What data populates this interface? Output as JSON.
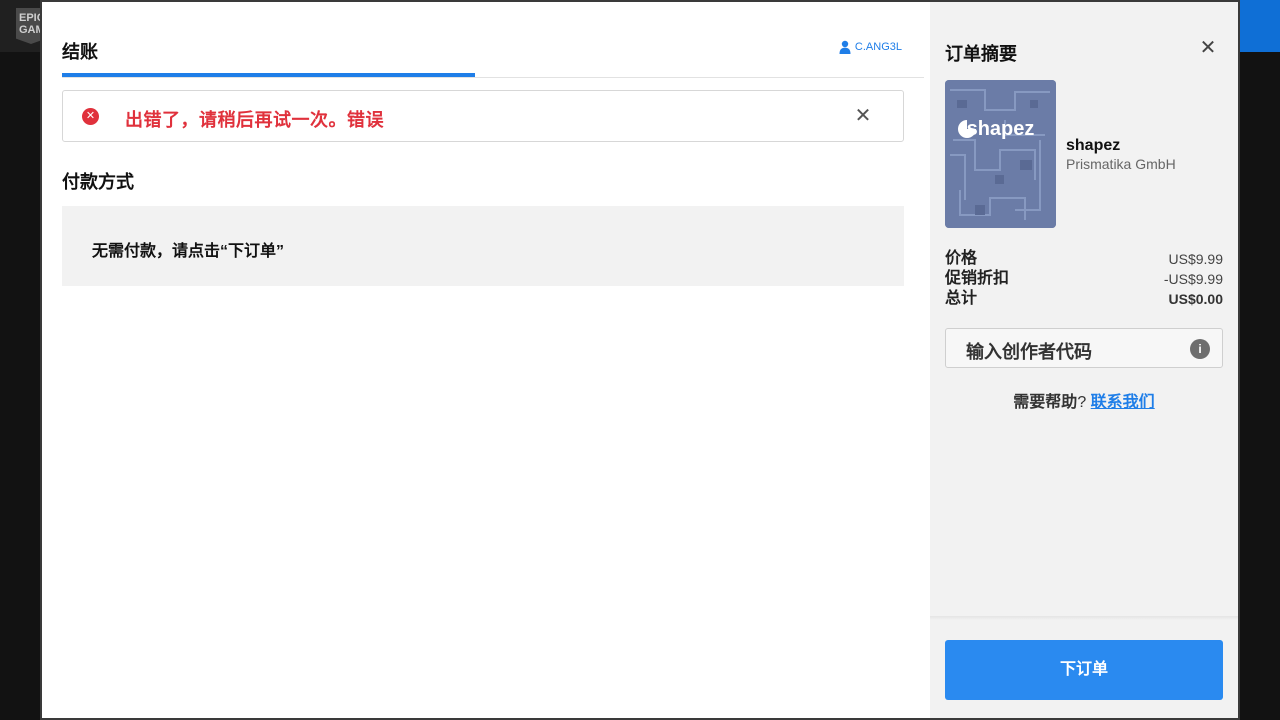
{
  "background": {
    "logo_text": "EPIC GAMES"
  },
  "checkout": {
    "tab_title": "结账",
    "account_name": "C.ANG3L",
    "error": {
      "message": "出错了，请稍后再试一次。错误",
      "close_icon": "close-icon"
    },
    "section_title": "付款方式",
    "payment_note": "无需付款，请点击“下订单”"
  },
  "summary": {
    "title": "订单摘要",
    "close_icon": "close-icon",
    "product": {
      "cover_text": "shapez",
      "name": "shapez",
      "developer": "Prismatika GmbH"
    },
    "price_rows": [
      {
        "label": "价格",
        "value": "US$9.99"
      },
      {
        "label": "促销折扣",
        "value": "-US$9.99"
      },
      {
        "label": "总计",
        "value": "US$0.00"
      }
    ],
    "creator_code_placeholder": "输入创作者代码",
    "help_prefix": "需要帮助",
    "help_qmark": "?",
    "help_link": "联系我们",
    "place_order": "下订单"
  },
  "colors": {
    "accent": "#1f7ee8",
    "error": "#e0313c",
    "button": "#2a8af0"
  }
}
